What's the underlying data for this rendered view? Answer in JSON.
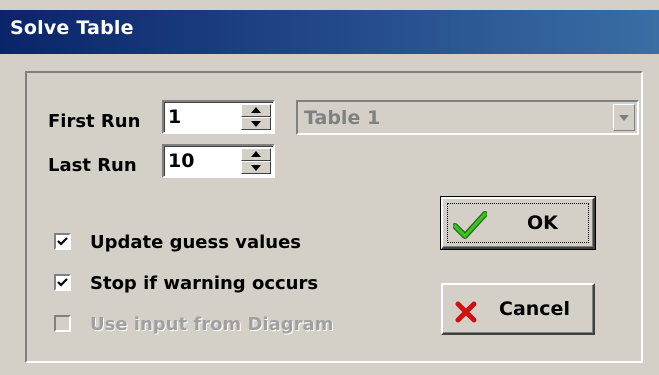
{
  "window": {
    "title": "Solve Table"
  },
  "first_run": {
    "label": "First Run",
    "value": "1"
  },
  "last_run": {
    "label": "Last Run",
    "value": "10"
  },
  "table_select": {
    "value": "Table 1"
  },
  "options": {
    "update_guess": {
      "label": "Update guess values",
      "checked": true
    },
    "stop_warning": {
      "label": "Stop if warning occurs",
      "checked": true
    },
    "use_diagram": {
      "label": "Use input from Diagram",
      "checked": false,
      "disabled": true
    }
  },
  "buttons": {
    "ok_label": "OK",
    "cancel_label": "Cancel"
  },
  "icons": {
    "ok": "green-checkmark-icon",
    "cancel": "red-x-icon"
  },
  "colors": {
    "titlebar_start": "#0a246a",
    "titlebar_end": "#3a6ea5",
    "dialog_face": "#d4d0c8",
    "ok_check": "#2e9e1a",
    "cancel_x": "#d01010",
    "disabled_text": "#a0a0a0"
  }
}
